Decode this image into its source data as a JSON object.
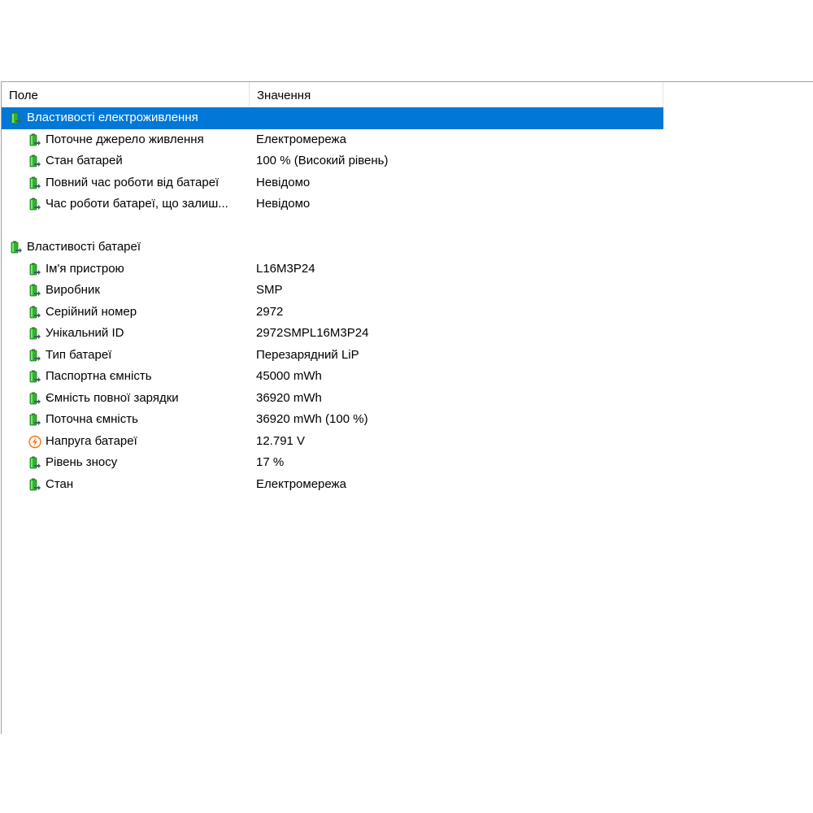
{
  "columns": {
    "field": "Поле",
    "value": "Значення"
  },
  "groups": [
    {
      "label": "Властивості електроживлення",
      "icon": "battery-icon",
      "selected": true,
      "items": [
        {
          "label": "Поточне джерело живлення",
          "value": "Електромережа",
          "icon": "battery-icon"
        },
        {
          "label": "Стан батарей",
          "value": "100 % (Високий рівень)",
          "icon": "battery-icon"
        },
        {
          "label": "Повний час роботи від батареї",
          "value": "Невідомо",
          "icon": "battery-icon"
        },
        {
          "label": "Час роботи батареї, що залиш...",
          "value": "Невідомо",
          "icon": "battery-icon"
        }
      ]
    },
    {
      "label": "Властивості батареї",
      "icon": "battery-icon",
      "selected": false,
      "items": [
        {
          "label": "Ім'я пристрою",
          "value": "L16M3P24",
          "icon": "battery-icon"
        },
        {
          "label": "Виробник",
          "value": "SMP",
          "icon": "battery-icon"
        },
        {
          "label": "Серійний номер",
          "value": "2972",
          "icon": "battery-icon"
        },
        {
          "label": "Унікальний ID",
          "value": "2972SMPL16M3P24",
          "icon": "battery-icon"
        },
        {
          "label": "Тип батареї",
          "value": "Перезарядний LiP",
          "icon": "battery-icon"
        },
        {
          "label": "Паспортна ємність",
          "value": "45000 mWh",
          "icon": "battery-icon"
        },
        {
          "label": "Ємність повної зарядки",
          "value": "36920 mWh",
          "icon": "battery-icon"
        },
        {
          "label": "Поточна ємність",
          "value": "36920 mWh  (100 %)",
          "icon": "battery-icon"
        },
        {
          "label": "Напруга батареї",
          "value": "12.791 V",
          "icon": "voltage-icon"
        },
        {
          "label": "Рівень зносу",
          "value": "17 %",
          "icon": "battery-icon"
        },
        {
          "label": "Стан",
          "value": "Електромережа",
          "icon": "battery-icon"
        }
      ]
    }
  ],
  "colors": {
    "selection": "#0078d7",
    "battery_green": "#2db52d",
    "battery_grey": "#7a8a8a",
    "voltage_orange": "#f07a1a"
  }
}
